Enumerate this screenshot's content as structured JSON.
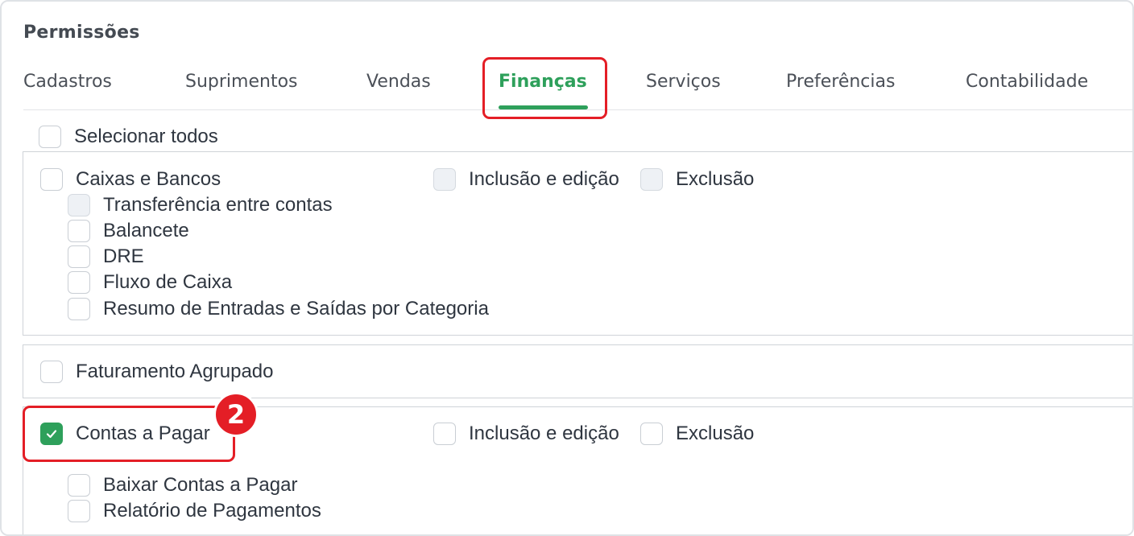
{
  "section_title": "Permissões",
  "tabs": [
    {
      "label": "Cadastros"
    },
    {
      "label": "Suprimentos"
    },
    {
      "label": "Vendas"
    },
    {
      "label": "Finanças",
      "active": true
    },
    {
      "label": "Serviços"
    },
    {
      "label": "Preferências"
    },
    {
      "label": "Contabilidade"
    }
  ],
  "select_all": {
    "label": "Selecionar todos",
    "checked": false
  },
  "caixas_bancos": {
    "label": "Caixas e Bancos",
    "inclusao": "Inclusão e edição",
    "exclusao": "Exclusão",
    "children": [
      "Transferência entre contas",
      "Balancete",
      "DRE",
      "Fluxo de Caixa",
      "Resumo de Entradas e Saídas por Categoria"
    ]
  },
  "faturamento": {
    "label": "Faturamento Agrupado"
  },
  "contas_pagar": {
    "label": "Contas a Pagar",
    "checked": true,
    "inclusao": "Inclusão e edição",
    "exclusao": "Exclusão",
    "children": [
      "Baixar Contas a Pagar",
      "Relatório de Pagamentos"
    ]
  },
  "step_badge": "2",
  "colors": {
    "accent": "#2ea05b",
    "highlight": "#e41e26"
  },
  "icons": {
    "check": "check-icon"
  }
}
